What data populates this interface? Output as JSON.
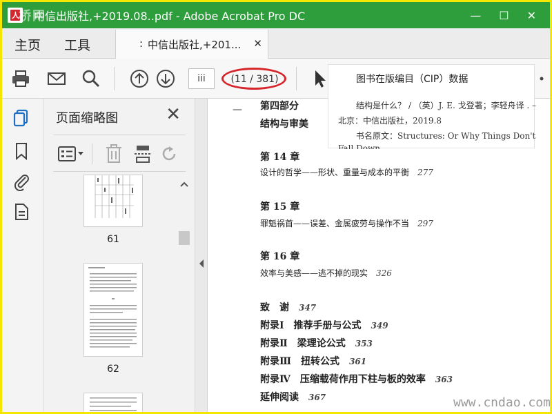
{
  "window": {
    "title": "中信出版社,+2019.08..pdf - Adobe Acrobat Pro DC",
    "watermark": "桥网",
    "controls": [
      "—",
      "☐",
      "✕"
    ]
  },
  "menu": {
    "home": "主页",
    "tools": "工具"
  },
  "tab": {
    "label": "中信出版社,+201...",
    "close": "✕"
  },
  "toolbar": {
    "page_input": "iii",
    "page_count": "(11 / 381)",
    "icons": [
      "print-icon",
      "mail-icon",
      "search-icon",
      "page-up-icon",
      "page-down-icon",
      "select-cursor-icon"
    ]
  },
  "thumbnails_panel": {
    "title": "页面缩略图",
    "close": "✕",
    "pages": [
      {
        "label": "61"
      },
      {
        "label": "62"
      }
    ]
  },
  "cip": {
    "title": "图书在版编目（CIP）数据",
    "lines": [
      "结构是什么？ / （英）J. E. 戈登著；李轻舟译 . –",
      "北京：中信出版社，2019.8",
      "书名原文：Structures: Or Why Things Don't",
      "Fall Down"
    ]
  },
  "toc": {
    "part": "第四部分",
    "part_title": "结构与审美",
    "entries": [
      {
        "chapter": "第 14 章",
        "title": "设计的哲学——形状、重量与成本的平衡",
        "page": "277"
      },
      {
        "chapter": "第 15 章",
        "title": "罪魁祸首——误差、金属疲劳与操作不当",
        "page": "297"
      },
      {
        "chapter": "第 16 章",
        "title": "效率与美感——逃不掉的现实",
        "page": "326"
      }
    ],
    "back": [
      {
        "label": "致　谢",
        "page": "347"
      },
      {
        "label": "附录Ⅰ　推荐手册与公式",
        "page": "349"
      },
      {
        "label": "附录Ⅱ　梁理论公式",
        "page": "353"
      },
      {
        "label": "附录Ⅲ　扭转公式",
        "page": "361"
      },
      {
        "label": "附录Ⅳ　压缩载荷作用下柱与板的效率",
        "page": "363"
      },
      {
        "label": "延伸阅读",
        "page": "367"
      }
    ]
  },
  "site_watermark": "www.cndao.com",
  "colors": {
    "titlebar": "#2e9d3b",
    "frame": "#f5e600",
    "highlight": "#d6262b",
    "accent_blue": "#1f6fc1"
  }
}
